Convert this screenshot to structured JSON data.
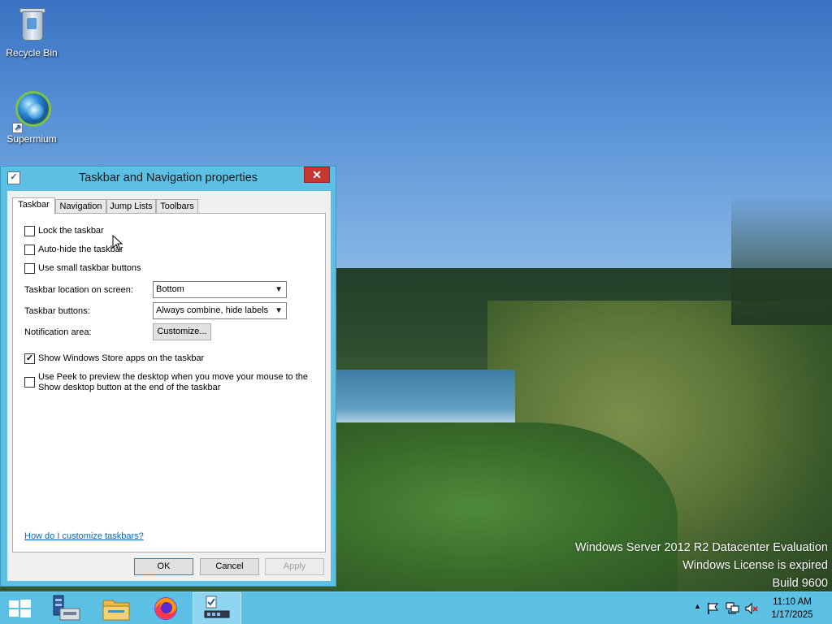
{
  "desktop": {
    "icons": [
      {
        "label": "Recycle Bin"
      },
      {
        "label": "Supermium"
      }
    ],
    "watermark": {
      "line1": "Windows Server 2012 R2 Datacenter Evaluation",
      "line2": "Windows License is expired",
      "line3": "Build 9600"
    }
  },
  "dialog": {
    "title": "Taskbar and Navigation properties",
    "close_glyph": "✕",
    "tabs": [
      {
        "label": "Taskbar"
      },
      {
        "label": "Navigation"
      },
      {
        "label": "Jump Lists"
      },
      {
        "label": "Toolbars"
      }
    ],
    "checkboxes": {
      "lock": {
        "label": "Lock the taskbar",
        "checked": false
      },
      "autohide": {
        "label": "Auto-hide the taskbar",
        "checked": false
      },
      "small": {
        "label": "Use small taskbar buttons",
        "checked": false
      },
      "store_apps": {
        "label": "Show Windows Store apps on the taskbar",
        "checked": true
      },
      "peek": {
        "label": "Use Peek to preview the desktop when you move your mouse to the Show desktop button at the end of the taskbar",
        "checked": false
      }
    },
    "location": {
      "label": "Taskbar location on screen:",
      "value": "Bottom"
    },
    "buttons_setting": {
      "label": "Taskbar buttons:",
      "value": "Always combine, hide labels"
    },
    "notification": {
      "label": "Notification area:",
      "button": "Customize..."
    },
    "help_link": "How do I customize taskbars?",
    "ok": "OK",
    "cancel": "Cancel",
    "apply": "Apply"
  },
  "taskbar": {
    "pinned": [
      {
        "name": "start-button"
      },
      {
        "name": "server-manager"
      },
      {
        "name": "file-explorer"
      },
      {
        "name": "firefox"
      },
      {
        "name": "taskbar-properties",
        "active": true
      }
    ],
    "clock": {
      "time": "11:10 AM",
      "date": "1/17/2025"
    }
  },
  "colors": {
    "taskbar": "#5cc0e4",
    "close_button": "#c7372f",
    "link": "#0066cc"
  }
}
